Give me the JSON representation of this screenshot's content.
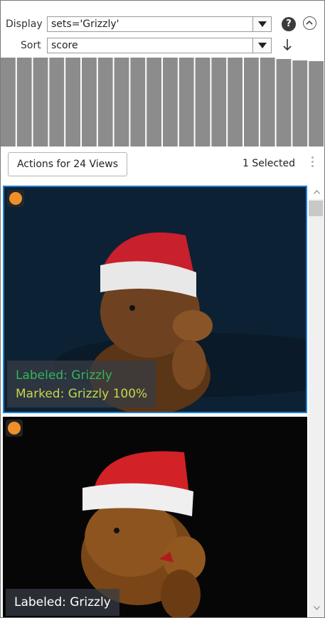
{
  "controls": {
    "display_label": "Display",
    "display_value": "sets='Grizzly'",
    "sort_label": "Sort",
    "sort_value": "score",
    "help_glyph": "?"
  },
  "toolbar": {
    "actions_label": "Actions for 24 Views",
    "selected_label": "1  Selected"
  },
  "cards": [
    {
      "labeled": "Labeled: Grizzly",
      "marked": "Marked: Grizzly 100%",
      "selected": true,
      "badge_color": "#ef8f2a"
    },
    {
      "labeled": "Labeled: Grizzly",
      "selected": false,
      "badge_color": "#ef8f2a"
    }
  ],
  "colors": {
    "selection_border": "#1e7fd4",
    "labeled_text_selected": "#35b55b",
    "marked_text": "#c6d64a",
    "labeled_text": "#ffffff",
    "histogram_bar": "#8c8c8c"
  }
}
